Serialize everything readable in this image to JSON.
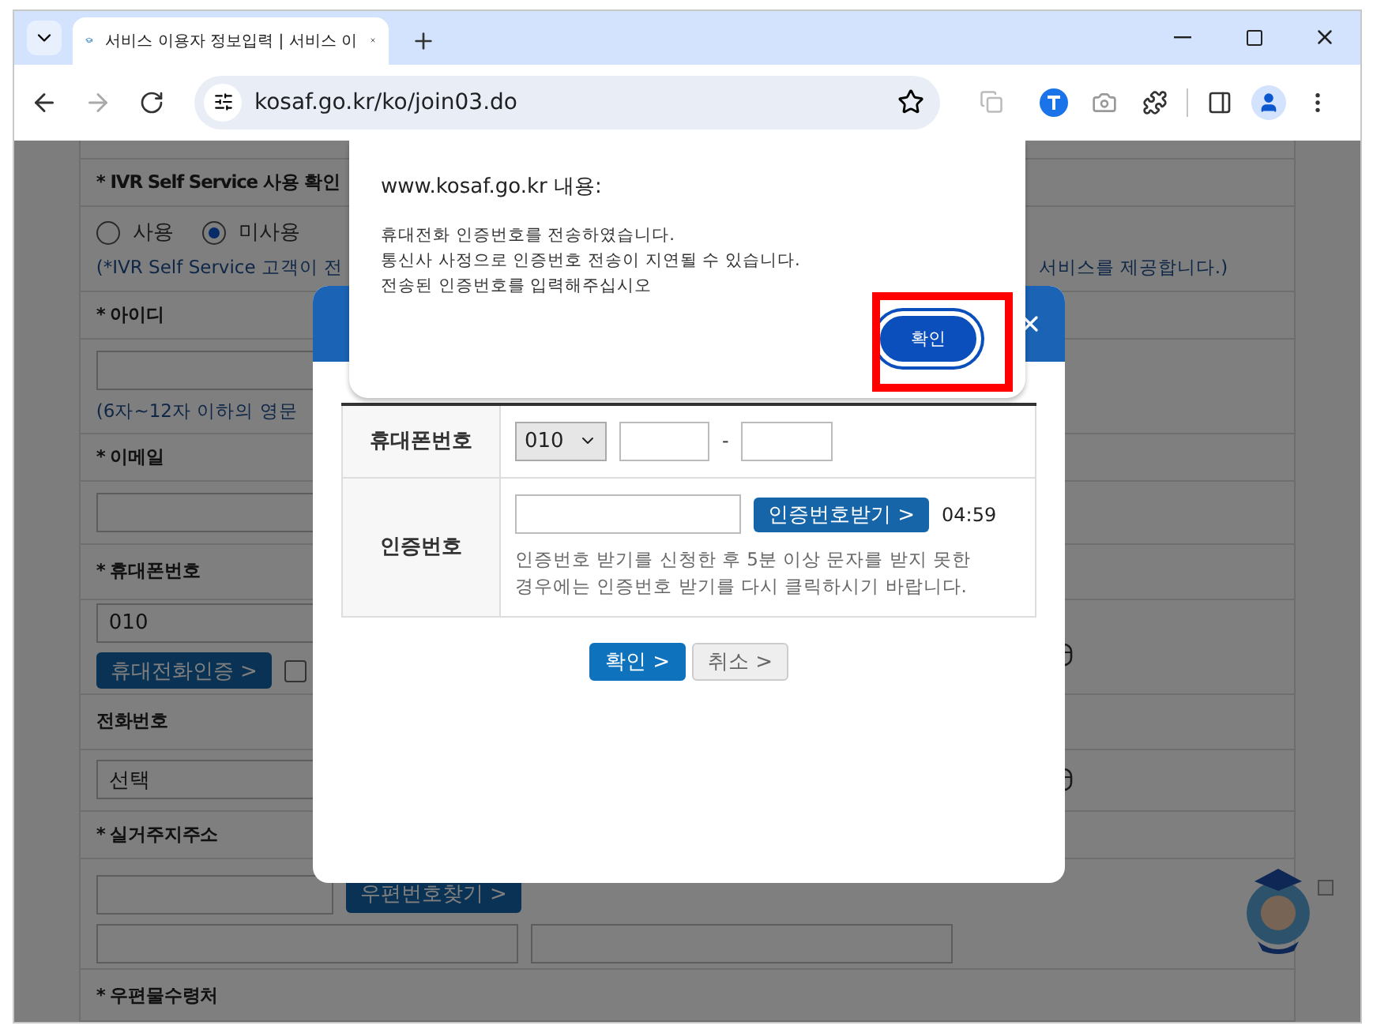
{
  "browser": {
    "tab_title": "서비스 이용자 정보입력 | 서비스 이",
    "url": "kosaf.go.kr/ko/join03.do"
  },
  "form": {
    "ivr": {
      "label": "* IVR Self Service 사용 확인",
      "options": [
        {
          "label": "사용",
          "selected": false
        },
        {
          "label": "미사용",
          "selected": true
        }
      ],
      "note": "(*IVR Self Service 고객이 전",
      "note_right": "서비스를 제공합니다.)"
    },
    "user_id": {
      "label": "* 아이디",
      "hint": "(6자~12자 이하의 영문"
    },
    "email": {
      "label": "* 이메일"
    },
    "mobile": {
      "label": "* 휴대폰번호",
      "value": "010",
      "button": "휴대전화인증 >",
      "checked": false
    },
    "phone": {
      "label": "전화번호",
      "value": "선택"
    },
    "address": {
      "label": "* 실거주지주소",
      "button": "우편번호찾기 >"
    },
    "mail": {
      "label": "* 우편물수령처"
    }
  },
  "modal": {
    "rows": [
      {
        "kind": "phone",
        "label": "휴대폰번호",
        "prefix": "010",
        "separator": "-"
      },
      {
        "kind": "code",
        "label": "인증번호",
        "button": "인증번호받기 >",
        "timer": "04:59",
        "note": "인증번호 받기를 신청한 후 5분 이상 문자를 받지 못한 경우에는 인증번호 받기를 다시 클릭하시기 바랍니다."
      }
    ],
    "buttons": [
      {
        "kind": "primary",
        "label": "확인 >"
      },
      {
        "kind": "secondary",
        "label": "취소 >"
      }
    ]
  },
  "alert": {
    "title": "www.kosaf.go.kr 내용:",
    "lines": [
      "휴대전화 인증번호를 전송하였습니다.",
      "통신사 사정으로 인증번호 전송이 지연될 수 있습니다.",
      "전송된 인증번호를 입력해주십시오"
    ],
    "button": "확인"
  }
}
